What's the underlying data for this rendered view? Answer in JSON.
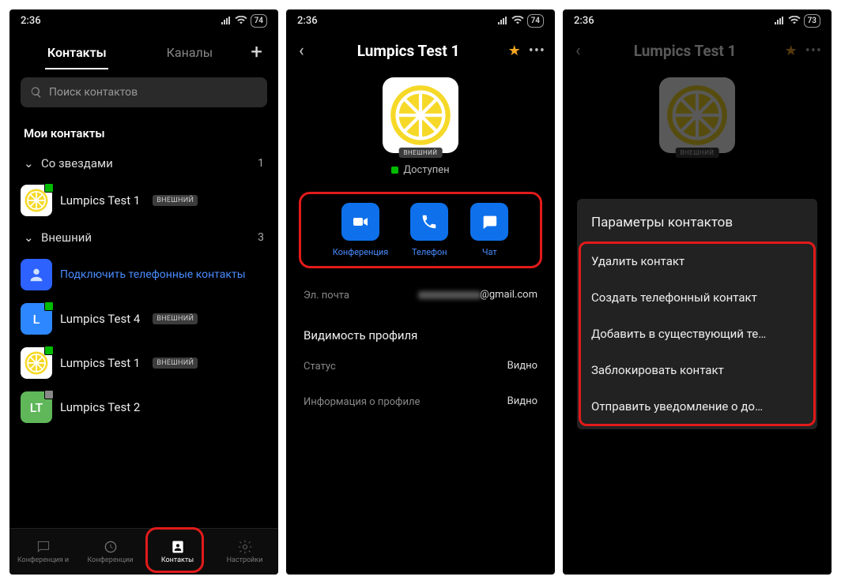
{
  "status": {
    "time": "2:36",
    "battery_a": "74",
    "battery_c": "73"
  },
  "s1": {
    "tab_contacts": "Контакты",
    "tab_channels": "Каналы",
    "search_placeholder": "Поиск контактов",
    "my_contacts": "Мои контакты",
    "group_starred": "Со звездами",
    "group_starred_count": "1",
    "group_external": "Внешний",
    "group_external_count": "3",
    "badge_external": "ВНЕШНИЙ",
    "connect_phone": "Подключить телефонные контакты",
    "contacts": [
      {
        "name": "Lumpics Test 1",
        "avatar": "lemon",
        "badge": true
      },
      {
        "name": "Lumpics  Test 4",
        "avatar": "L",
        "color": "#2d88ff",
        "badge": true
      },
      {
        "name": "Lumpics Test 1",
        "avatar": "lemon",
        "badge": true
      },
      {
        "name": "Lumpics Test 2",
        "avatar": "LT",
        "color": "#5fb75a",
        "badge": false
      }
    ],
    "nav": {
      "meet_chat": "Конференция и",
      "meetings": "Конференции",
      "contacts": "Контакты",
      "settings": "Настройки"
    }
  },
  "s2": {
    "title": "Lumpics Test 1",
    "ext_badge": "ВНЕШНИЙ",
    "presence": "Доступен",
    "action_meet": "Конференция",
    "action_phone": "Телефон",
    "action_chat": "Чат",
    "email_label": "Эл. почта",
    "email_value": "@gmail.com",
    "visibility_title": "Видимость профиля",
    "status_label": "Статус",
    "status_value": "Видно",
    "profile_info_label": "Информация о профиле",
    "profile_info_value": "Видно"
  },
  "s3": {
    "sheet_title": "Параметры контактов",
    "items": [
      "Удалить контакт",
      "Создать телефонный контакт",
      "Добавить в существующий те…",
      "Заблокировать контакт",
      "Отправить уведомление о до…"
    ]
  }
}
